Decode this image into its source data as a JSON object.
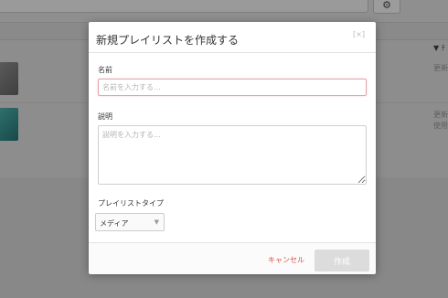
{
  "background": {
    "sort_label": "▼ ﾃ",
    "row1_meta": "更新",
    "row2_meta": "更新",
    "row2_meta2": "使用",
    "gear_icon": "⚙"
  },
  "modal": {
    "title": "新規プレイリストを作成する",
    "close_label": "[×]",
    "name_label": "名前",
    "name_placeholder": "名前を入力する...",
    "name_value": "",
    "description_label": "説明",
    "description_placeholder": "説明を入力する...",
    "description_value": "",
    "type_label": "プレイリストタイプ",
    "type_selected": "メディア",
    "type_arrow": "▼",
    "cancel_label": "キャンセル",
    "create_label": "作成"
  },
  "colors": {
    "cancel": "#d8504b",
    "create_disabled": "#dcdcdc",
    "name_focus_border": "#dea7af"
  }
}
